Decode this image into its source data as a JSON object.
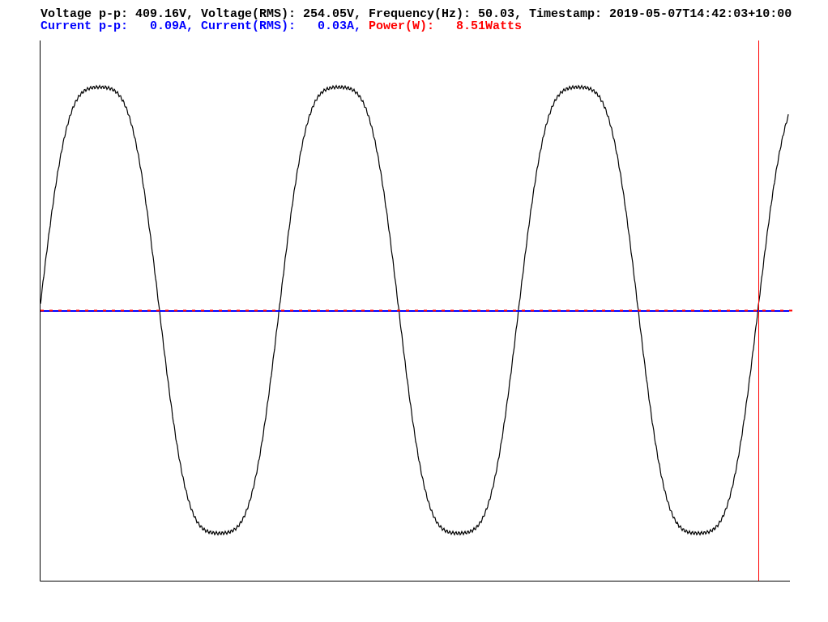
{
  "readouts": [
    {
      "items": [
        {
          "text": "Voltage p-p: 409.16V, Voltage(RMS): 254.05V, Frequency(Hz): 50.03, Timestamp: 2019-05-07T14:42:03+10:00",
          "color": "#000000"
        }
      ]
    },
    {
      "items": [
        {
          "text": "Current p-p:   0.09A, Current(RMS):   0.03A,",
          "color": "#0000ff"
        },
        {
          "text": "Power(W):   8.51Watts",
          "color": "#ff0000"
        }
      ]
    }
  ]
}
